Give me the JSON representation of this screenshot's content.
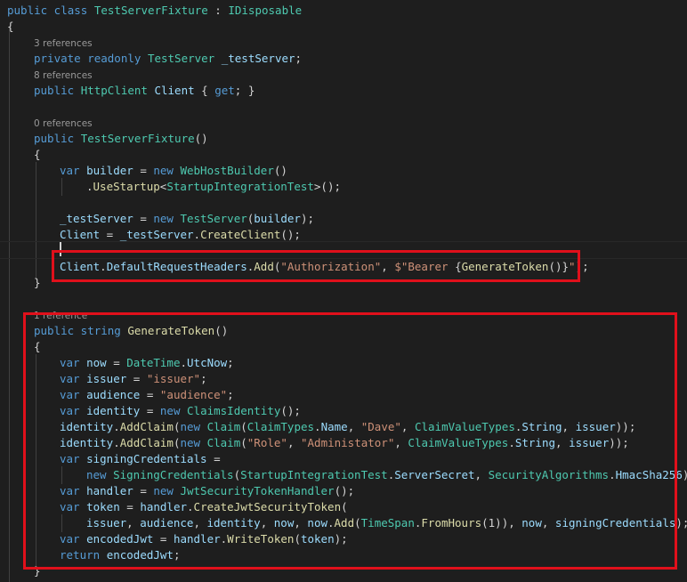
{
  "editor": {
    "code_lens": {
      "l1": "3 references",
      "l2": "8 references",
      "l3": "0 references",
      "l4": "1 reference"
    },
    "lines": [
      [
        [
          "kw",
          "public class "
        ],
        [
          "ty",
          "TestServerFixture"
        ],
        [
          "pl",
          " : "
        ],
        [
          "ty",
          "IDisposable"
        ]
      ],
      [
        [
          "pl",
          "{"
        ]
      ],
      [
        [
          "kw",
          "private readonly "
        ],
        [
          "ty",
          "TestServer"
        ],
        [
          "pl",
          " "
        ],
        [
          "id",
          "_testServer"
        ],
        [
          "pl",
          ";"
        ]
      ],
      [
        [
          "kw",
          "public "
        ],
        [
          "ty",
          "HttpClient"
        ],
        [
          "pl",
          " "
        ],
        [
          "id",
          "Client"
        ],
        [
          "pl",
          " { "
        ],
        [
          "kw",
          "get"
        ],
        [
          "pl",
          "; }"
        ]
      ],
      [
        [
          "kw",
          "public "
        ],
        [
          "ty",
          "TestServerFixture"
        ],
        [
          "pl",
          "()"
        ]
      ],
      [
        [
          "pl",
          "{"
        ]
      ],
      [
        [
          "kw",
          "var "
        ],
        [
          "id",
          "builder"
        ],
        [
          "pl",
          " = "
        ],
        [
          "kw",
          "new "
        ],
        [
          "ty",
          "WebHostBuilder"
        ],
        [
          "pl",
          "()"
        ]
      ],
      [
        [
          "pl",
          "."
        ],
        [
          "fn",
          "UseStartup"
        ],
        [
          "pl",
          "<"
        ],
        [
          "ty",
          "StartupIntegrationTest"
        ],
        [
          "pl",
          ">();"
        ]
      ],
      [
        [
          "id",
          "_testServer"
        ],
        [
          "pl",
          " = "
        ],
        [
          "kw",
          "new "
        ],
        [
          "ty",
          "TestServer"
        ],
        [
          "pl",
          "("
        ],
        [
          "id",
          "builder"
        ],
        [
          "pl",
          ");"
        ]
      ],
      [
        [
          "id",
          "Client"
        ],
        [
          "pl",
          " = "
        ],
        [
          "id",
          "_testServer"
        ],
        [
          "pl",
          "."
        ],
        [
          "fn",
          "CreateClient"
        ],
        [
          "pl",
          "();"
        ]
      ],
      [
        [
          "id",
          "Client"
        ],
        [
          "pl",
          "."
        ],
        [
          "id",
          "DefaultRequestHeaders"
        ],
        [
          "pl",
          "."
        ],
        [
          "fn",
          "Add"
        ],
        [
          "pl",
          "("
        ],
        [
          "str",
          "\"Authorization\""
        ],
        [
          "pl",
          ", "
        ],
        [
          "str",
          "$\"Bearer "
        ],
        [
          "pl",
          "{"
        ],
        [
          "fn",
          "GenerateToken"
        ],
        [
          "pl",
          "()}"
        ],
        [
          "str",
          "\""
        ],
        [
          "pl",
          ");"
        ]
      ],
      [
        [
          "pl",
          "}"
        ]
      ],
      [
        [
          "kw",
          "public string "
        ],
        [
          "fn",
          "GenerateToken"
        ],
        [
          "pl",
          "()"
        ]
      ],
      [
        [
          "pl",
          "{"
        ]
      ],
      [
        [
          "kw",
          "var "
        ],
        [
          "id",
          "now"
        ],
        [
          "pl",
          " = "
        ],
        [
          "ty",
          "DateTime"
        ],
        [
          "pl",
          "."
        ],
        [
          "id",
          "UtcNow"
        ],
        [
          "pl",
          ";"
        ]
      ],
      [
        [
          "kw",
          "var "
        ],
        [
          "id",
          "issuer"
        ],
        [
          "pl",
          " = "
        ],
        [
          "str",
          "\"issuer\""
        ],
        [
          "pl",
          ";"
        ]
      ],
      [
        [
          "kw",
          "var "
        ],
        [
          "id",
          "audience"
        ],
        [
          "pl",
          " = "
        ],
        [
          "str",
          "\"audience\""
        ],
        [
          "pl",
          ";"
        ]
      ],
      [
        [
          "kw",
          "var "
        ],
        [
          "id",
          "identity"
        ],
        [
          "pl",
          " = "
        ],
        [
          "kw",
          "new "
        ],
        [
          "ty",
          "ClaimsIdentity"
        ],
        [
          "pl",
          "();"
        ]
      ],
      [
        [
          "id",
          "identity"
        ],
        [
          "pl",
          "."
        ],
        [
          "fn",
          "AddClaim"
        ],
        [
          "pl",
          "("
        ],
        [
          "kw",
          "new "
        ],
        [
          "ty",
          "Claim"
        ],
        [
          "pl",
          "("
        ],
        [
          "ty",
          "ClaimTypes"
        ],
        [
          "pl",
          "."
        ],
        [
          "id",
          "Name"
        ],
        [
          "pl",
          ", "
        ],
        [
          "str",
          "\"Dave\""
        ],
        [
          "pl",
          ", "
        ],
        [
          "ty",
          "ClaimValueTypes"
        ],
        [
          "pl",
          "."
        ],
        [
          "id",
          "String"
        ],
        [
          "pl",
          ", "
        ],
        [
          "id",
          "issuer"
        ],
        [
          "pl",
          "));"
        ]
      ],
      [
        [
          "id",
          "identity"
        ],
        [
          "pl",
          "."
        ],
        [
          "fn",
          "AddClaim"
        ],
        [
          "pl",
          "("
        ],
        [
          "kw",
          "new "
        ],
        [
          "ty",
          "Claim"
        ],
        [
          "pl",
          "("
        ],
        [
          "str",
          "\"Role\""
        ],
        [
          "pl",
          ", "
        ],
        [
          "str",
          "\"Administator\""
        ],
        [
          "pl",
          ", "
        ],
        [
          "ty",
          "ClaimValueTypes"
        ],
        [
          "pl",
          "."
        ],
        [
          "id",
          "String"
        ],
        [
          "pl",
          ", "
        ],
        [
          "id",
          "issuer"
        ],
        [
          "pl",
          "));"
        ]
      ],
      [
        [
          "kw",
          "var "
        ],
        [
          "id",
          "signingCredentials"
        ],
        [
          "pl",
          " ="
        ]
      ],
      [
        [
          "kw",
          "new "
        ],
        [
          "ty",
          "SigningCredentials"
        ],
        [
          "pl",
          "("
        ],
        [
          "ty",
          "StartupIntegrationTest"
        ],
        [
          "pl",
          "."
        ],
        [
          "id",
          "ServerSecret"
        ],
        [
          "pl",
          ", "
        ],
        [
          "ty",
          "SecurityAlgorithms"
        ],
        [
          "pl",
          "."
        ],
        [
          "id",
          "HmacSha256"
        ],
        [
          "pl",
          ");"
        ]
      ],
      [
        [
          "kw",
          "var "
        ],
        [
          "id",
          "handler"
        ],
        [
          "pl",
          " = "
        ],
        [
          "kw",
          "new "
        ],
        [
          "ty",
          "JwtSecurityTokenHandler"
        ],
        [
          "pl",
          "();"
        ]
      ],
      [
        [
          "kw",
          "var "
        ],
        [
          "id",
          "token"
        ],
        [
          "pl",
          " = "
        ],
        [
          "id",
          "handler"
        ],
        [
          "pl",
          "."
        ],
        [
          "fn",
          "CreateJwtSecurityToken"
        ],
        [
          "pl",
          "("
        ]
      ],
      [
        [
          "id",
          "issuer"
        ],
        [
          "pl",
          ", "
        ],
        [
          "id",
          "audience"
        ],
        [
          "pl",
          ", "
        ],
        [
          "id",
          "identity"
        ],
        [
          "pl",
          ", "
        ],
        [
          "id",
          "now"
        ],
        [
          "pl",
          ", "
        ],
        [
          "id",
          "now"
        ],
        [
          "pl",
          "."
        ],
        [
          "fn",
          "Add"
        ],
        [
          "pl",
          "("
        ],
        [
          "ty",
          "TimeSpan"
        ],
        [
          "pl",
          "."
        ],
        [
          "fn",
          "FromHours"
        ],
        [
          "pl",
          "(1)), "
        ],
        [
          "id",
          "now"
        ],
        [
          "pl",
          ", "
        ],
        [
          "id",
          "signingCredentials"
        ],
        [
          "pl",
          ");"
        ]
      ],
      [
        [
          "kw",
          "var "
        ],
        [
          "id",
          "encodedJwt"
        ],
        [
          "pl",
          " = "
        ],
        [
          "id",
          "handler"
        ],
        [
          "pl",
          "."
        ],
        [
          "fn",
          "WriteToken"
        ],
        [
          "pl",
          "("
        ],
        [
          "id",
          "token"
        ],
        [
          "pl",
          ");"
        ]
      ],
      [
        [
          "kw",
          "return "
        ],
        [
          "id",
          "encodedJwt"
        ],
        [
          "pl",
          ";"
        ]
      ],
      [
        [
          "pl",
          "}"
        ]
      ]
    ]
  },
  "colors": {
    "background": "#1e1e1e",
    "keyword": "#569cd6",
    "type": "#4ec9b0",
    "function": "#dcdcaa",
    "identifier": "#9cdcfe",
    "string": "#ce9178",
    "highlight": "#e0101b"
  }
}
